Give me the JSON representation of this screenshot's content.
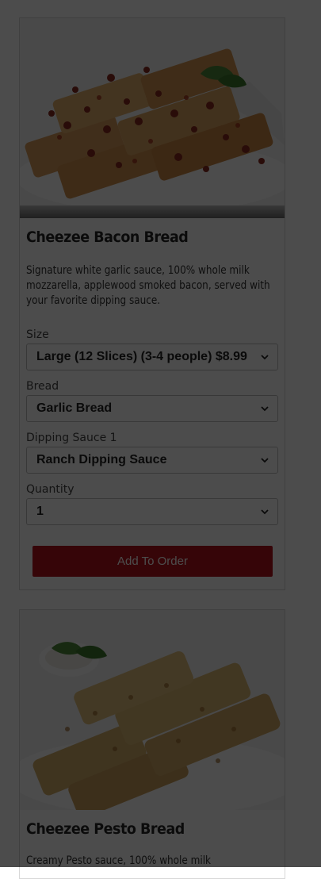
{
  "items": [
    {
      "title": "Cheezee Bacon Bread",
      "description": "Signature white garlic sauce, 100% whole milk mozzarella, applewood smoked bacon, served with your favorite dipping sauce.",
      "options": [
        {
          "label": "Size",
          "value": "Large (12 Slices) (3-4 people) $8.99"
        },
        {
          "label": "Bread",
          "value": "Garlic Bread"
        },
        {
          "label": "Dipping Sauce 1",
          "value": "Ranch Dipping Sauce"
        },
        {
          "label": "Quantity",
          "value": "1"
        }
      ],
      "add_label": "Add To Order"
    },
    {
      "title": "Cheezee Pesto Bread",
      "description": "Creamy Pesto sauce, 100% whole milk"
    }
  ],
  "colors": {
    "accent": "#b5121b",
    "overlay": "rgba(0,0,0,0.70)"
  }
}
